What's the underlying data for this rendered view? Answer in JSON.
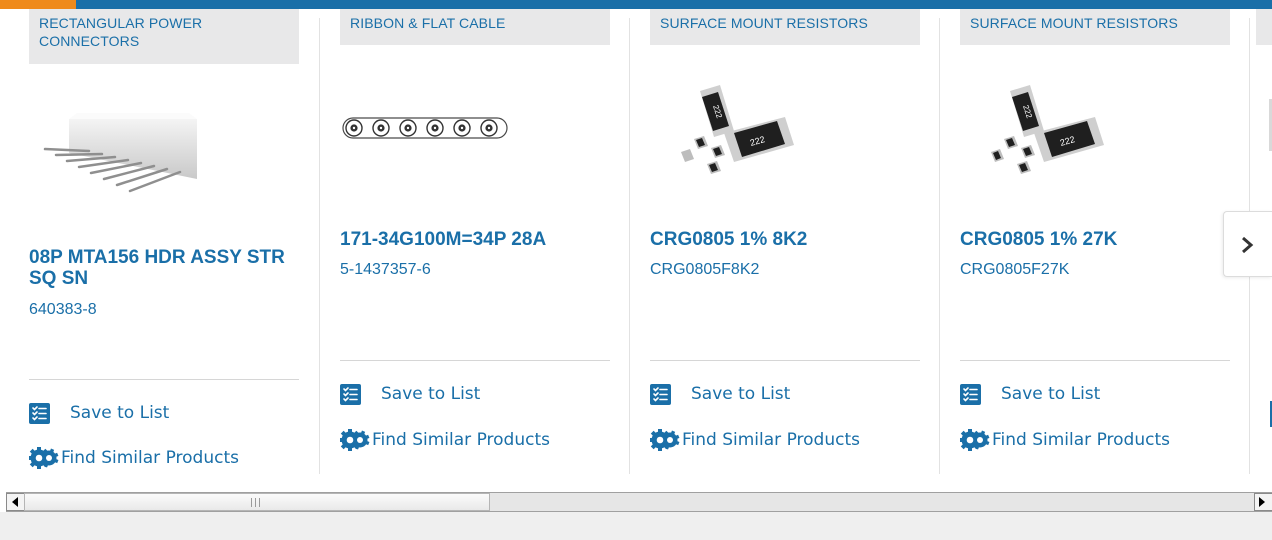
{
  "carousel": {
    "cards": [
      {
        "category": "RECTANGULAR POWER CONNECTORS",
        "name": "08P MTA156 HDR ASSY STR SQ SN",
        "part_number": "640383-8",
        "image_icon": "connector-header-image",
        "save_label": "Save to List",
        "similar_label": "Find Similar Products"
      },
      {
        "category": "RIBBON & FLAT CABLE",
        "name": "171-34G100M=34P 28A",
        "part_number": "5-1437357-6",
        "image_icon": "ribbon-cable-image",
        "save_label": "Save to List",
        "similar_label": "Find Similar Products"
      },
      {
        "category": "SURFACE MOUNT RESISTORS",
        "name": "CRG0805 1% 8K2",
        "part_number": "CRG0805F8K2",
        "image_icon": "smd-resistor-image",
        "image_marking": "222",
        "save_label": "Save to List",
        "similar_label": "Find Similar Products"
      },
      {
        "category": "SURFACE MOUNT RESISTORS",
        "name": "CRG0805 1% 27K",
        "part_number": "CRG0805F27K",
        "image_icon": "smd-resistor-image",
        "image_marking": "222",
        "save_label": "Save to List",
        "similar_label": "Find Similar Products"
      }
    ],
    "next_icon": "chevron-right-icon"
  },
  "scrollbar": {
    "left_icon": "arrow-left-icon",
    "right_icon": "arrow-right-icon"
  },
  "colors": {
    "brand_blue": "#1a6fa8",
    "accent_orange": "#ef8a1b",
    "category_bg": "#e8e8e9"
  }
}
